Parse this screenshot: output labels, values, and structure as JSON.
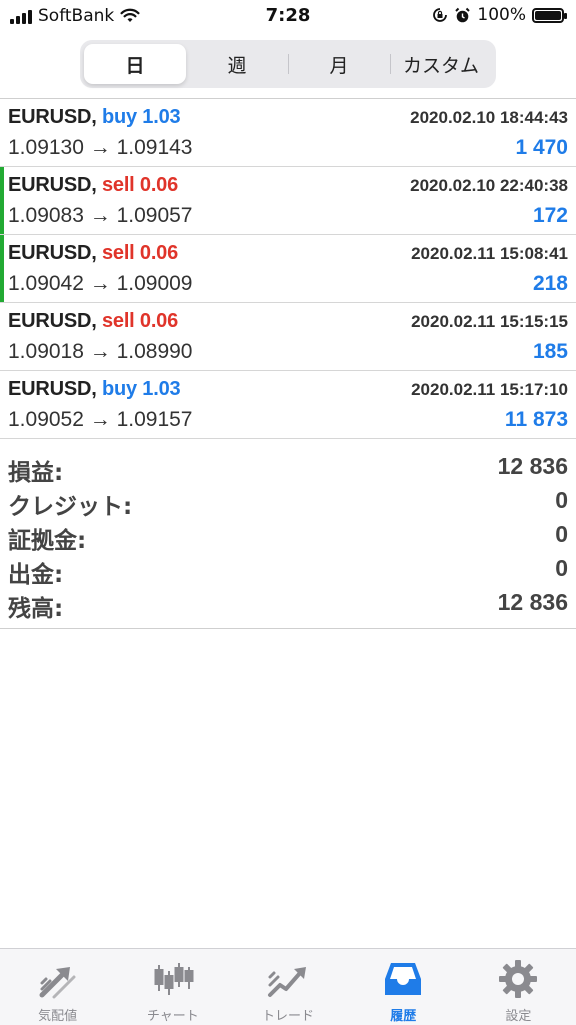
{
  "status_bar": {
    "carrier": "SoftBank",
    "time": "7:28",
    "battery": "100%",
    "battery_level": 1.0
  },
  "segments": [
    {
      "label": "日",
      "active": true
    },
    {
      "label": "週",
      "active": false
    },
    {
      "label": "月",
      "active": false
    },
    {
      "label": "カスタム",
      "active": false
    }
  ],
  "trades": [
    {
      "symbol": "EURUSD,",
      "direction": "buy 1.03",
      "type": "buy",
      "time": "2020.02.10 18:44:43",
      "prices": "1.09130 → 1.09143",
      "profit": "1 470",
      "marked": false
    },
    {
      "symbol": "EURUSD,",
      "direction": "sell 0.06",
      "type": "sell",
      "time": "2020.02.10 22:40:38",
      "prices": "1.09083 → 1.09057",
      "profit": "172",
      "marked": true
    },
    {
      "symbol": "EURUSD,",
      "direction": "sell 0.06",
      "type": "sell",
      "time": "2020.02.11 15:08:41",
      "prices": "1.09042 → 1.09009",
      "profit": "218",
      "marked": true
    },
    {
      "symbol": "EURUSD,",
      "direction": "sell 0.06",
      "type": "sell",
      "time": "2020.02.11 15:15:15",
      "prices": "1.09018 → 1.08990",
      "profit": "185",
      "marked": false
    },
    {
      "symbol": "EURUSD,",
      "direction": "buy 1.03",
      "type": "buy",
      "time": "2020.02.11 15:17:10",
      "prices": "1.09052 → 1.09157",
      "profit": "11 873",
      "marked": false
    }
  ],
  "summary": [
    {
      "label": "損益:",
      "value": "12 836"
    },
    {
      "label": "クレジット:",
      "value": "0"
    },
    {
      "label": "証拠金:",
      "value": "0"
    },
    {
      "label": "出金:",
      "value": "0"
    },
    {
      "label": "残高:",
      "value": "12 836"
    }
  ],
  "tabs": [
    {
      "label": "気配値",
      "icon": "quotes-arrows-icon",
      "active": false
    },
    {
      "label": "チャート",
      "icon": "candlestick-chart-icon",
      "active": false
    },
    {
      "label": "トレード",
      "icon": "trade-trend-icon",
      "active": false
    },
    {
      "label": "履歴",
      "icon": "history-inbox-icon",
      "active": true
    },
    {
      "label": "設定",
      "icon": "settings-gear-icon",
      "active": false
    }
  ],
  "colors": {
    "accent": "#1f7ce8",
    "sell": "#e0342a",
    "marker": "#22aa33",
    "inactive_icon": "#8a8a8f"
  }
}
